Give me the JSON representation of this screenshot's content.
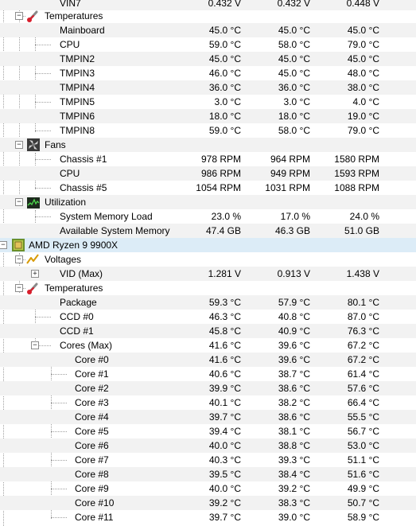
{
  "rows": [
    {
      "label": "VIN7",
      "v1": "0.432 V",
      "v2": "0.432 V",
      "v3": "0.448 V"
    },
    {
      "label": "Temperatures"
    },
    {
      "label": "Mainboard",
      "v1": "45.0 °C",
      "v2": "45.0 °C",
      "v3": "45.0 °C"
    },
    {
      "label": "CPU",
      "v1": "59.0 °C",
      "v2": "58.0 °C",
      "v3": "79.0 °C"
    },
    {
      "label": "TMPIN2",
      "v1": "45.0 °C",
      "v2": "45.0 °C",
      "v3": "45.0 °C"
    },
    {
      "label": "TMPIN3",
      "v1": "46.0 °C",
      "v2": "45.0 °C",
      "v3": "48.0 °C"
    },
    {
      "label": "TMPIN4",
      "v1": "36.0 °C",
      "v2": "36.0 °C",
      "v3": "38.0 °C"
    },
    {
      "label": "TMPIN5",
      "v1": "3.0 °C",
      "v2": "3.0 °C",
      "v3": "4.0 °C"
    },
    {
      "label": "TMPIN6",
      "v1": "18.0 °C",
      "v2": "18.0 °C",
      "v3": "19.0 °C"
    },
    {
      "label": "TMPIN8",
      "v1": "59.0 °C",
      "v2": "58.0 °C",
      "v3": "79.0 °C"
    },
    {
      "label": "Fans"
    },
    {
      "label": "Chassis #1",
      "v1": "978 RPM",
      "v2": "964 RPM",
      "v3": "1580 RPM"
    },
    {
      "label": "CPU",
      "v1": "986 RPM",
      "v2": "949 RPM",
      "v3": "1593 RPM"
    },
    {
      "label": "Chassis #5",
      "v1": "1054 RPM",
      "v2": "1031 RPM",
      "v3": "1088 RPM"
    },
    {
      "label": "Utilization"
    },
    {
      "label": "System Memory Load",
      "v1": "23.0 %",
      "v2": "17.0 %",
      "v3": "24.0 %"
    },
    {
      "label": "Available System Memory",
      "v1": "47.4 GB",
      "v2": "46.3 GB",
      "v3": "51.0 GB"
    },
    {
      "label": "AMD Ryzen 9 9900X"
    },
    {
      "label": "Voltages"
    },
    {
      "label": "VID (Max)",
      "v1": "1.281 V",
      "v2": "0.913 V",
      "v3": "1.438 V"
    },
    {
      "label": "Temperatures"
    },
    {
      "label": "Package",
      "v1": "59.3 °C",
      "v2": "57.9 °C",
      "v3": "80.1 °C"
    },
    {
      "label": "CCD #0",
      "v1": "46.3 °C",
      "v2": "40.8 °C",
      "v3": "87.0 °C"
    },
    {
      "label": "CCD #1",
      "v1": "45.8 °C",
      "v2": "40.9 °C",
      "v3": "76.3 °C"
    },
    {
      "label": "Cores (Max)",
      "v1": "41.6 °C",
      "v2": "39.6 °C",
      "v3": "67.2 °C"
    },
    {
      "label": "Core #0",
      "v1": "41.6 °C",
      "v2": "39.6 °C",
      "v3": "67.2 °C"
    },
    {
      "label": "Core #1",
      "v1": "40.6 °C",
      "v2": "38.7 °C",
      "v3": "61.4 °C"
    },
    {
      "label": "Core #2",
      "v1": "39.9 °C",
      "v2": "38.6 °C",
      "v3": "57.6 °C"
    },
    {
      "label": "Core #3",
      "v1": "40.1 °C",
      "v2": "38.2 °C",
      "v3": "66.4 °C"
    },
    {
      "label": "Core #4",
      "v1": "39.7 °C",
      "v2": "38.6 °C",
      "v3": "55.5 °C"
    },
    {
      "label": "Core #5",
      "v1": "39.4 °C",
      "v2": "38.1 °C",
      "v3": "56.7 °C"
    },
    {
      "label": "Core #6",
      "v1": "40.0 °C",
      "v2": "38.8 °C",
      "v3": "53.0 °C"
    },
    {
      "label": "Core #7",
      "v1": "40.3 °C",
      "v2": "39.3 °C",
      "v3": "51.1 °C"
    },
    {
      "label": "Core #8",
      "v1": "39.5 °C",
      "v2": "38.4 °C",
      "v3": "51.6 °C"
    },
    {
      "label": "Core #9",
      "v1": "40.0 °C",
      "v2": "39.2 °C",
      "v3": "49.9 °C"
    },
    {
      "label": "Core #10",
      "v1": "39.2 °C",
      "v2": "38.3 °C",
      "v3": "50.7 °C"
    },
    {
      "label": "Core #11",
      "v1": "39.7 °C",
      "v2": "39.0 °C",
      "v3": "58.9 °C"
    }
  ]
}
